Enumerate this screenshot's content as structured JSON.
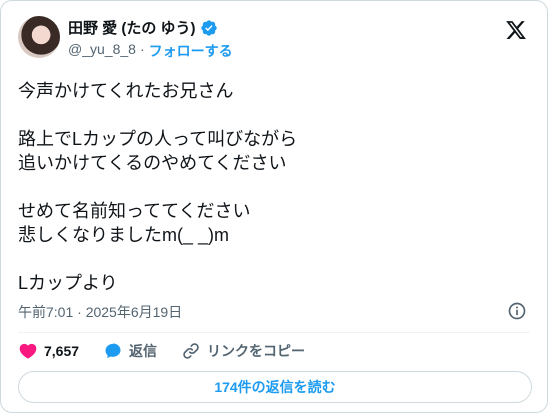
{
  "author": {
    "display_name": "田野 愛 (たの ゆう)",
    "handle": "@_yu_8_8",
    "separator": "·",
    "follow_label": "フォローする"
  },
  "tweet": {
    "lines": [
      "今声かけてくれたお兄さん",
      "",
      "路上でLカップの人って叫びながら",
      "追いかけてくるのやめてください",
      "",
      "せめて名前知っててください",
      "悲しくなりましたm(_ _)m",
      "",
      "Lカップより"
    ],
    "timestamp": "午前7:01 · 2025年6月19日"
  },
  "actions": {
    "like_count": "7,657",
    "reply_label": "返信",
    "copy_link_label": "リンクをコピー"
  },
  "read_replies_label": "174件の返信を読む",
  "colors": {
    "accent": "#1d9bf0",
    "like": "#f91880",
    "text": "#0f1419",
    "muted": "#536471"
  }
}
